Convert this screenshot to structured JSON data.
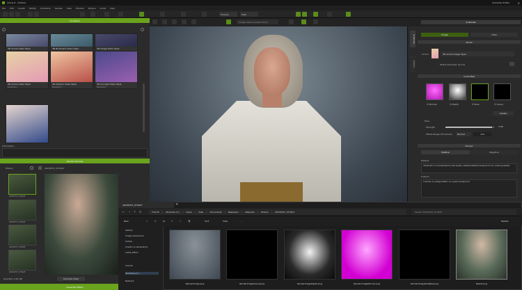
{
  "window": {
    "title": "iClone 8 - Untitled",
    "controls_right": "Character Profile"
  },
  "menu": [
    "File",
    "Edit",
    "Create",
    "Modify",
    "Animation",
    "Render",
    "View",
    "Window",
    "Plugins",
    "Script",
    "Help"
  ],
  "toolbar": {
    "render_mode": "Preview",
    "quality": "High",
    "search_placeholder": "Image Online Content Store"
  },
  "left_panel": {
    "title": "AI Gallery",
    "cards": [
      {
        "title": "3D Anime Video Style",
        "sub": "Realisation"
      },
      {
        "title": "3D Bookmark Video Style",
        "sub": "Realisation"
      },
      {
        "title": "3D Image Video Style",
        "sub": "Realisation"
      },
      {
        "title": "3D Anime Video Style",
        "sub": "Realisation"
      },
      {
        "title": "3D Cartoon Video Style",
        "sub": "Realisation"
      },
      {
        "title": "3D Concept Video Style",
        "sub": "Realisation"
      }
    ],
    "info_label": "Information",
    "render_preview": {
      "title": "Render Preview",
      "history_label": "History",
      "folder": "20230707_0734AT",
      "thumb_labels": [
        "20230707_0734AT",
        "20230707_0734AT",
        "20230707_0734AT",
        "20230707_0734AT"
      ],
      "quantity": "Quantity: 1/10 (M)",
      "override_button": "Override Video",
      "bottom_button": "Generate (Beta)"
    }
  },
  "right_panel": {
    "title": "AI Render",
    "tabs": [
      "Image",
      "Video"
    ],
    "side_tabs": [
      "AI Render",
      "Modify"
    ],
    "model_section": "Model",
    "ai_tool_label": "AI Tool",
    "ai_tool_value": "3D Anime Image Style",
    "model_name": "Model Character (Lucid)",
    "controlnet_section": "ControlNet",
    "controlnets": [
      {
        "label": "Normal",
        "checked": true
      },
      {
        "label": "Depth",
        "checked": true
      },
      {
        "label": "Pose",
        "checked": true
      },
      {
        "label": "Canny",
        "checked": true
      }
    ],
    "update_button": "Update",
    "pose_label": "Pose",
    "strength_label": "Strength",
    "strength_value": "1.00",
    "strength_fraction": 0.95,
    "offset_label": "Offset Range (Threshold)",
    "offset_preset": "Normal",
    "offset_value": "114",
    "prompt_section": "Prompt",
    "prompt_tabs": [
      "Positive",
      "Negative"
    ],
    "default_label": "Default",
    "default_text": "(illustration:1.2),(masterpiece, best quality, detailed,detailed background:1.2), wearing sweater",
    "custom_label": "Custom",
    "custom_text": "a woman in a beige pattern on a green background"
  },
  "explorer": {
    "tab_title": "20230707_0734AT",
    "breadcrumb": [
      "This PC",
      "Windows (C:)",
      "Users",
      "Imak",
      "Documents",
      "Reallusion",
      "AIRender",
      "History",
      "20230707_0734AT"
    ],
    "search_placeholder": "Search 20230707_0734AT",
    "new_button": "New",
    "sort_button": "Sort",
    "view_button": "View",
    "details_button": "Details",
    "sidebar": [
      "Gallery",
      "Image Sequences",
      "InVoke",
      "Creator & Generators",
      "Lottie_Effect",
      "This PC",
      "Windows (C:)",
      "Network"
    ],
    "files": [
      {
        "name": "RenderImage.png",
        "kind": "render"
      },
      {
        "name": "RenderImageCanny.png",
        "kind": "canny"
      },
      {
        "name": "RenderImageDepth.png",
        "kind": "depth"
      },
      {
        "name": "RenderImageNormal.png",
        "kind": "normal"
      },
      {
        "name": "RenderImagePoseNew.png",
        "kind": "pose"
      },
      {
        "name": "Result.png",
        "kind": "result"
      }
    ]
  },
  "colors": {
    "accent": "#6aa31d",
    "panel": "#2b2b2b",
    "dark": "#1a1a1a"
  }
}
